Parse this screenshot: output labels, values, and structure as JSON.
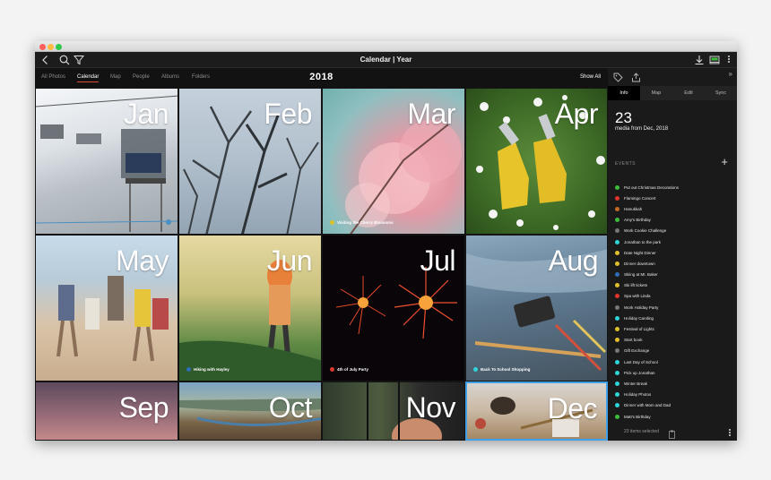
{
  "window": {
    "title": "Calendar | Year"
  },
  "toolbar": {
    "back_icon": "chevron-left-icon",
    "search_icon": "search-icon",
    "filter_icon": "filter-icon",
    "import_icon": "download-icon",
    "upload_icon": "upload-tray-icon",
    "more_icon": "kebab-icon"
  },
  "nav": {
    "tabs": [
      {
        "label": "All Photos",
        "active": false
      },
      {
        "label": "Calendar",
        "active": true
      },
      {
        "label": "Map",
        "active": false
      },
      {
        "label": "People",
        "active": false
      },
      {
        "label": "Albums",
        "active": false
      },
      {
        "label": "Folders",
        "active": false
      }
    ],
    "year": "2018",
    "show_all": "Show All"
  },
  "months": [
    {
      "name": "Jan",
      "event": "",
      "event_color": ""
    },
    {
      "name": "Feb",
      "event": "",
      "event_color": ""
    },
    {
      "name": "Mar",
      "event": "Visiting the Cherry Blossoms",
      "event_color": "#d8c22c"
    },
    {
      "name": "Apr",
      "event": "",
      "event_color": ""
    },
    {
      "name": "May",
      "event": "",
      "event_color": ""
    },
    {
      "name": "Jun",
      "event": "Hiking with Hayley",
      "event_color": "#2d6db5"
    },
    {
      "name": "Jul",
      "event": "4th of July Party",
      "event_color": "#d83a2e"
    },
    {
      "name": "Aug",
      "event": "Back To School Shopping",
      "event_color": "#2ed4d8"
    },
    {
      "name": "Sep",
      "event": "",
      "event_color": ""
    },
    {
      "name": "Oct",
      "event": "",
      "event_color": ""
    },
    {
      "name": "Nov",
      "event": "",
      "event_color": ""
    },
    {
      "name": "Dec",
      "event": "",
      "event_color": "",
      "selected": true
    }
  ],
  "sidebar": {
    "tabs": [
      {
        "label": "Info",
        "active": true
      },
      {
        "label": "Map",
        "active": false
      },
      {
        "label": "Edit",
        "active": false
      },
      {
        "label": "Sync",
        "active": false
      }
    ],
    "count": "23",
    "count_sub": "media from Dec, 2018",
    "events_heading": "EVENTS",
    "add_label": "+",
    "events": [
      {
        "label": "Put out Christmas Decorations",
        "color": "#3dbb3d"
      },
      {
        "label": "Flamingo Concert",
        "color": "#e0342c"
      },
      {
        "label": "Hanukkah",
        "color": "#c46a26"
      },
      {
        "label": "Amy's Birthday",
        "color": "#3dbb3d"
      },
      {
        "label": "Work Cookie Challenge",
        "color": "#777777"
      },
      {
        "label": "Jonathan to the park",
        "color": "#2ed4d8"
      },
      {
        "label": "Date Night Dinner",
        "color": "#e0c02a"
      },
      {
        "label": "Dinner downtown",
        "color": "#e0c02a"
      },
      {
        "label": "Skiing at Mt. Baker",
        "color": "#2d6db5"
      },
      {
        "label": "Ski lift tickets",
        "color": "#e0c02a"
      },
      {
        "label": "Spa with Linda",
        "color": "#e0342c"
      },
      {
        "label": "Work Holiday Party",
        "color": "#777777"
      },
      {
        "label": "Holiday Caroling",
        "color": "#2ed4d8"
      },
      {
        "label": "Festival of Lights",
        "color": "#e0c02a"
      },
      {
        "label": "Start book",
        "color": "#e0c02a"
      },
      {
        "label": "Gift Exchange",
        "color": "#777777"
      },
      {
        "label": "Last Day of School",
        "color": "#2ed4d8"
      },
      {
        "label": "Pick up Jonathan",
        "color": "#2ed4d8"
      },
      {
        "label": "Winter Break",
        "color": "#2ed4d8"
      },
      {
        "label": "Holiday Photos",
        "color": "#2ed4d8"
      },
      {
        "label": "Dinner with Mom and Dad",
        "color": "#2ed4d8"
      },
      {
        "label": "Matt's Birthday",
        "color": "#3dbb3d"
      }
    ],
    "selected_label": "23 items selected",
    "expand_label": "»"
  }
}
